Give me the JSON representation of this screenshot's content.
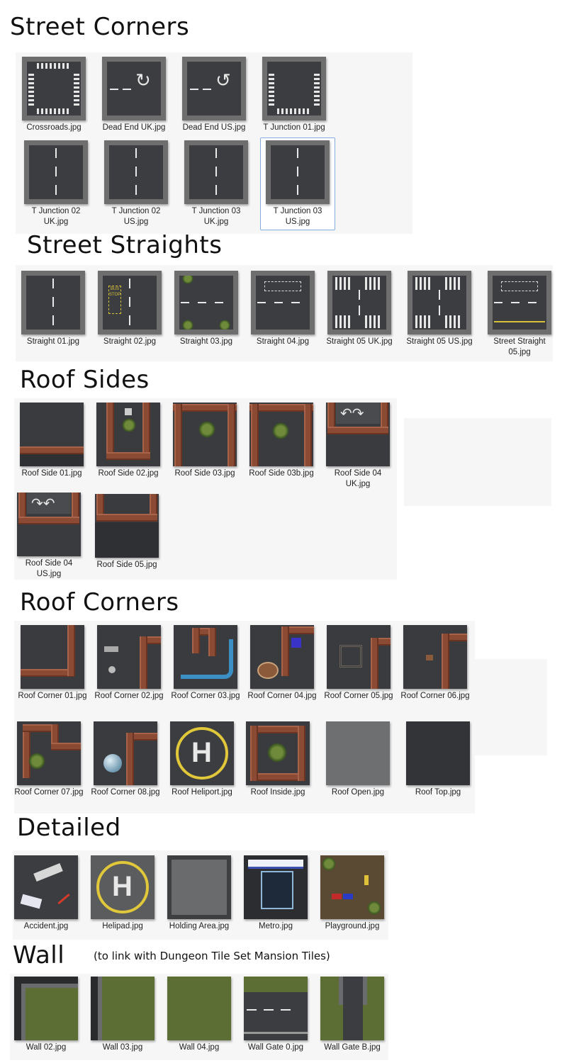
{
  "sections": {
    "street_corners": "Street Corners",
    "street_straights": "Street Straights",
    "roof_sides": "Roof Sides",
    "roof_corners": "Roof Corners",
    "detailed": "Detailed",
    "wall": "Wall",
    "wall_note": "(to link with Dungeon Tile Set Mansion Tiles)"
  },
  "files": {
    "crossroads": "Crossroads.jpg",
    "dead_end_uk": "Dead End UK.jpg",
    "dead_end_us": "Dead End US.jpg",
    "t_junction_01": "T Junction 01.jpg",
    "t_junction_02_uk": "T Junction 02 UK.jpg",
    "t_junction_02_us": "T Junction 02 US.jpg",
    "t_junction_03_uk": "T Junction 03 UK.jpg",
    "t_junction_03_us": "T Junction 03 US.jpg",
    "straight_01": "Straight 01.jpg",
    "straight_02": "Straight 02.jpg",
    "straight_03": "Straight 03.jpg",
    "straight_04": "Straight 04.jpg",
    "straight_05_uk": "Straight 05 UK.jpg",
    "straight_05_us": "Straight 05 US.jpg",
    "street_straight_05": "Street Straight 05.jpg",
    "roof_side_01": "Roof Side 01.jpg",
    "roof_side_02": "Roof Side 02.jpg",
    "roof_side_03": "Roof Side 03.jpg",
    "roof_side_03b": "Roof Side 03b.jpg",
    "roof_side_04_uk": "Roof Side 04 UK.jpg",
    "roof_side_04_us": "Roof Side 04 US.jpg",
    "roof_side_05": "Roof Side 05.jpg",
    "roof_corner_01": "Roof Corner 01.jpg",
    "roof_corner_02": "Roof Corner 02.jpg",
    "roof_corner_03": "Roof Corner 03.jpg",
    "roof_corner_04": "Roof Corner 04.jpg",
    "roof_corner_05": "Roof Corner 05.jpg",
    "roof_corner_06": "Roof Corner 06.jpg",
    "roof_corner_07": "Roof Corner 07.jpg",
    "roof_corner_08": "Roof Corner 08.jpg",
    "roof_heliport": "Roof Heliport.jpg",
    "roof_inside": "Roof Inside.jpg",
    "roof_open": "Roof Open.jpg",
    "roof_top": "Roof Top.jpg",
    "accident": "Accident.jpg",
    "helipad": "Helipad.jpg",
    "holding_area": "Holding Area.jpg",
    "metro": "Metro.jpg",
    "playground": "Playground.jpg",
    "wall_02": "Wall 02.jpg",
    "wall_03": "Wall 03.jpg",
    "wall_04": "Wall 04.jpg",
    "wall_gate_0": "Wall Gate 0.jpg",
    "wall_gate_b": "Wall Gate B.jpg"
  },
  "thumbnail_text": {
    "bus_stop": "BUS STOP",
    "helipad_letter": "H"
  },
  "colors": {
    "asphalt": "#3b3d40",
    "curb": "#6e6e6e",
    "brick": "#8a4a34",
    "grass": "#5d6e34",
    "selection_border": "#84acdd"
  }
}
